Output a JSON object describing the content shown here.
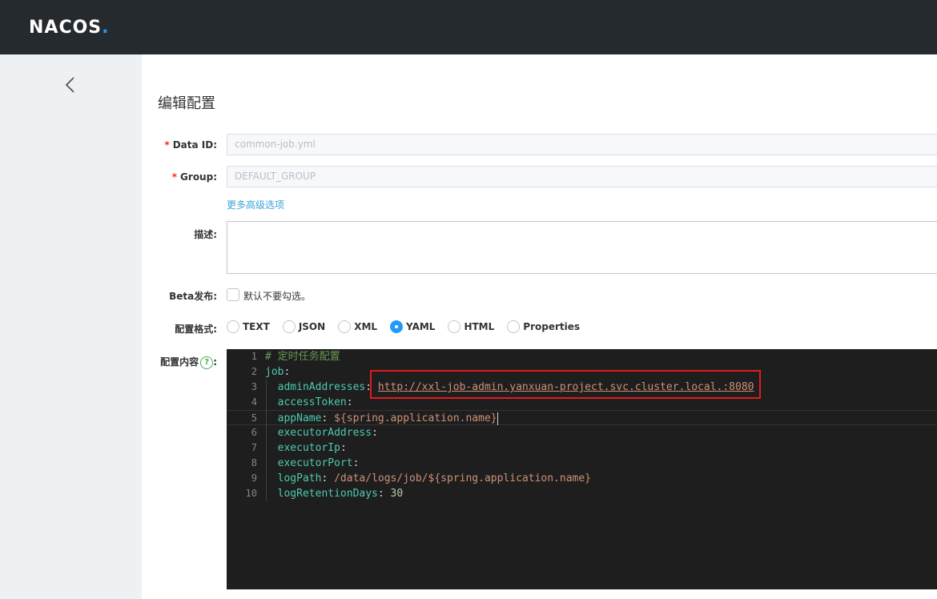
{
  "header": {
    "logo_text": "NACOS",
    "logo_dot": "."
  },
  "page": {
    "title": "编辑配置"
  },
  "form": {
    "data_id": {
      "label": "Data ID:",
      "required_mark": "*",
      "value": "common-job.yml"
    },
    "group": {
      "label": "Group:",
      "required_mark": "*",
      "value": "DEFAULT_GROUP"
    },
    "advanced_link": "更多高级选项",
    "description": {
      "label": "描述:",
      "value": ""
    },
    "beta": {
      "label": "Beta发布:",
      "hint": "默认不要勾选。",
      "checked": false
    },
    "format": {
      "label": "配置格式:",
      "options": [
        "TEXT",
        "JSON",
        "XML",
        "YAML",
        "HTML",
        "Properties"
      ],
      "selected": "YAML"
    },
    "content": {
      "label": "配置内容",
      "help_icon": "?",
      "colon": ":"
    }
  },
  "editor": {
    "lines": [
      {
        "n": "1",
        "comment": "# 定时任务配置"
      },
      {
        "n": "2",
        "key": "job",
        "sep": ":"
      },
      {
        "n": "3",
        "key": "adminAddresses",
        "sep": ": ",
        "url": "http://xxl-job-admin.yanxuan-project.svc.cluster.local.:8080"
      },
      {
        "n": "4",
        "key": "accessToken",
        "sep": ":"
      },
      {
        "n": "5",
        "key": "appName",
        "sep": ": ",
        "value": "${spring.application.name}"
      },
      {
        "n": "6",
        "key": "executorAddress",
        "sep": ":"
      },
      {
        "n": "7",
        "key": "executorIp",
        "sep": ":"
      },
      {
        "n": "8",
        "key": "executorPort",
        "sep": ":"
      },
      {
        "n": "9",
        "key": "logPath",
        "sep": ": ",
        "value": "/data/logs/job/${spring.application.name}"
      },
      {
        "n": "10",
        "key": "logRetentionDays",
        "sep": ": ",
        "num": "30"
      }
    ]
  },
  "colors": {
    "accent": "#209bfa",
    "header_bg": "#252a2f",
    "annotation": "#e21b1b"
  }
}
